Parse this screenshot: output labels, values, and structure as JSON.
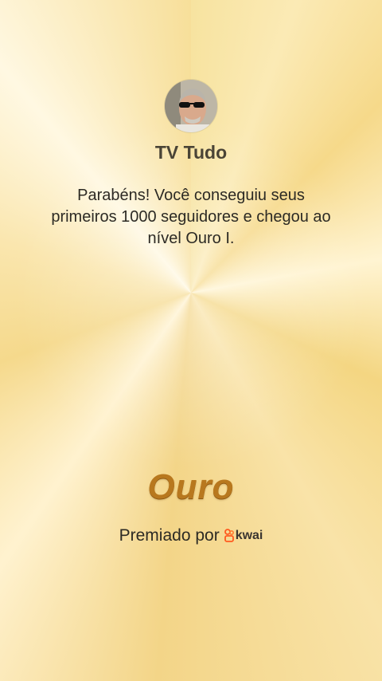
{
  "profile": {
    "name": "TV Tudo",
    "avatar_icon": "user-photo-avatar"
  },
  "message": "Parabéns! Você conseguiu seus primeiros 1000 seguidores e chegou ao nível Ouro I.",
  "level": {
    "label": "Ouro",
    "color": "#b8781e"
  },
  "footer": {
    "premiado_label": "Premiado por",
    "brand_name": "kwai",
    "brand_icon": "kwai-logo-icon",
    "brand_color": "#ff5a1f"
  },
  "colors": {
    "background": "#f7df9a",
    "text": "#2c2a24"
  }
}
